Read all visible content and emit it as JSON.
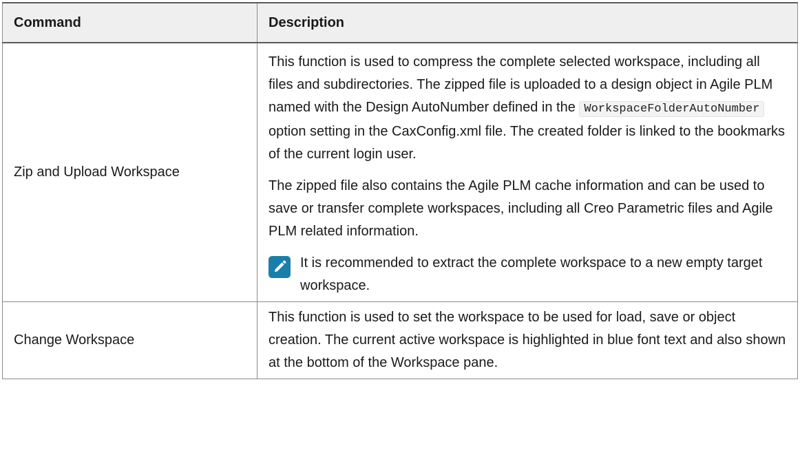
{
  "table": {
    "headers": {
      "command": "Command",
      "description": "Description"
    },
    "rows": [
      {
        "command": "Zip and Upload Workspace",
        "p1_before": "This function is used to compress the complete selected workspace, including all files and subdirectories. The zipped file is uploaded to a design object in Agile PLM named with the Design AutoNumber defined in the ",
        "p1_code": "WorkspaceFolderAutoNumber",
        "p1_after": " option setting in the CaxConfig.xml file. The created folder is linked to the bookmarks of the current login user.",
        "p2": "The zipped file also contains the Agile PLM cache information and can be used to save or transfer complete workspaces, including all Creo Parametric files and Agile PLM related information.",
        "note_icon": "edit-pencil-icon",
        "note": "It is recommended to extract the complete workspace to a new empty target workspace."
      },
      {
        "command": "Change Workspace",
        "description": "This function is used to set the workspace to be used for load, save or object creation. The current active workspace is highlighted in blue font text and also shown at the bottom of the Workspace pane."
      }
    ]
  },
  "colors": {
    "header_bg": "#efefef",
    "border": "#8a8a8a",
    "note_icon_bg": "#1a7fa8"
  }
}
